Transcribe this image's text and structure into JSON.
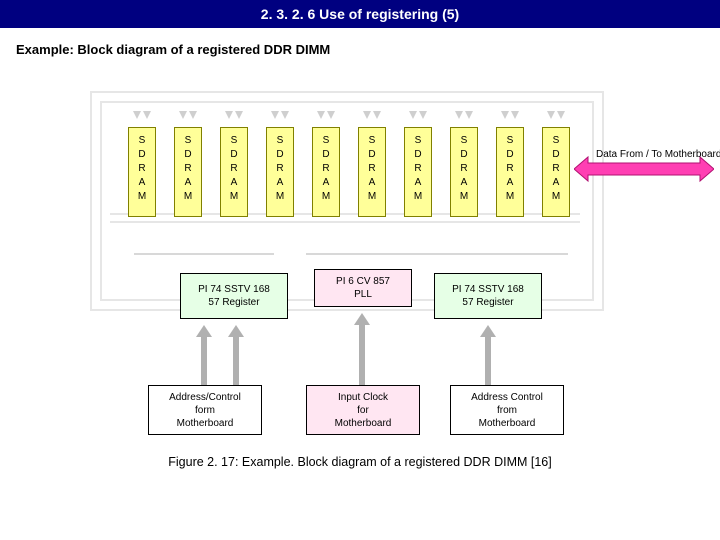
{
  "title": "2. 3. 2. 6  Use of registering (5)",
  "subtitle": "Example: Block diagram of a registered DDR DIMM",
  "sdram_label": "SDRAM",
  "data_arrow_label": "Data From / To Motherboard",
  "reg": {
    "left": {
      "line1": "PI 74 SSTV 168",
      "line2": "57 Register"
    },
    "mid": {
      "line1": "PI 6 CV 857",
      "line2": "PLL"
    },
    "right": {
      "line1": "PI 74 SSTV 168",
      "line2": "57 Register"
    }
  },
  "src": {
    "left": {
      "line1": "Address/Control",
      "line2": "form",
      "line3": "Motherboard"
    },
    "mid": {
      "line1": "Input Clock",
      "line2": "for",
      "line3": "Motherboard"
    },
    "right": {
      "line1": "Address Control",
      "line2": "from",
      "line3": "Motherboard"
    }
  },
  "caption": "Figure 2. 17: Example. Block diagram of a registered DDR DIMM [16]"
}
